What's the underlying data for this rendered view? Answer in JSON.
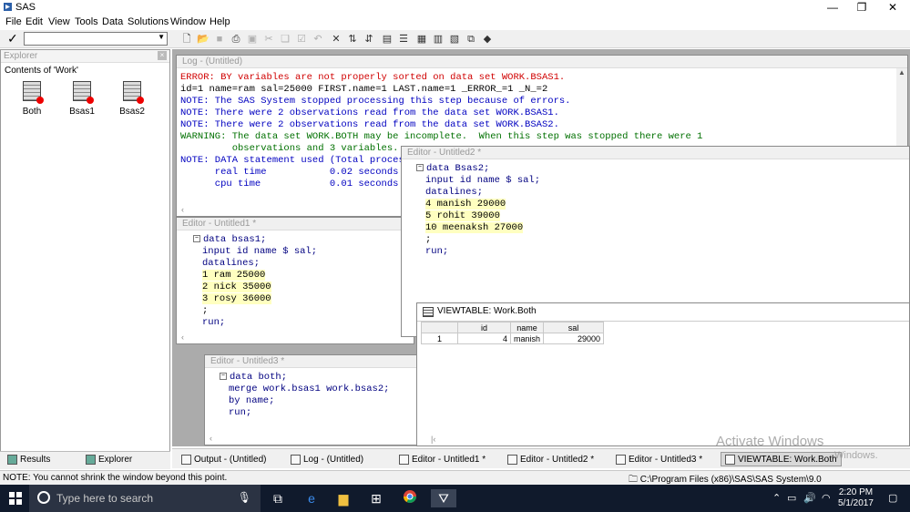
{
  "window": {
    "title": "SAS"
  },
  "menu": [
    "File",
    "Edit",
    "View",
    "Tools",
    "Data",
    "Solutions",
    "Window",
    "Help"
  ],
  "explorer": {
    "header": "Explorer",
    "subtitle": "Contents of 'Work'",
    "datasets": [
      "Both",
      "Bsas1",
      "Bsas2"
    ]
  },
  "left_tabs": {
    "results": "Results",
    "explorer": "Explorer"
  },
  "log": {
    "title": "Log - (Untitled)",
    "lines": [
      {
        "cls": "err",
        "text": "ERROR: BY variables are not properly sorted on data set WORK.BSAS1."
      },
      {
        "cls": "",
        "text": "id=1 name=ram sal=25000 FIRST.name=1 LAST.name=1 _ERROR_=1 _N_=2"
      },
      {
        "cls": "note",
        "text": "NOTE: The SAS System stopped processing this step because of errors."
      },
      {
        "cls": "note",
        "text": "NOTE: There were 2 observations read from the data set WORK.BSAS1."
      },
      {
        "cls": "note",
        "text": "NOTE: There were 2 observations read from the data set WORK.BSAS2."
      },
      {
        "cls": "warn",
        "text": "WARNING: The data set WORK.BOTH may be incomplete.  When this step was stopped there were 1"
      },
      {
        "cls": "warn",
        "text": "         observations and 3 variables."
      },
      {
        "cls": "note",
        "text": "NOTE: DATA statement used (Total process time):"
      },
      {
        "cls": "note",
        "text": "      real time           0.02 seconds"
      },
      {
        "cls": "note",
        "text": "      cpu time            0.01 seconds"
      }
    ]
  },
  "editor1": {
    "title": "Editor - Untitled1 *",
    "lines": [
      "data bsas1;",
      "input id name $ sal;",
      "datalines;",
      "1 ram 25000",
      "2 nick 35000",
      "3 rosy 36000",
      ";",
      "run;"
    ]
  },
  "editor2": {
    "title": "Editor - Untitled2 *",
    "lines": [
      "data Bsas2;",
      "input id name $ sal;",
      "datalines;",
      "4 manish 29000",
      "5 rohit 39000",
      "10 meenaksh 27000",
      ";",
      "run;"
    ]
  },
  "editor3": {
    "title": "Editor - Untitled3 *",
    "lines": [
      "data both;",
      "merge work.bsas1 work.bsas2;",
      "by name;",
      "run;"
    ]
  },
  "viewtable": {
    "title": "VIEWTABLE: Work.Both",
    "columns": [
      "id",
      "name",
      "sal"
    ],
    "rows": [
      {
        "row": "1",
        "id": "4",
        "name": "manish",
        "sal": "29000"
      }
    ]
  },
  "sas_tabs": [
    "Output - (Untitled)",
    "Log - (Untitled)",
    "Editor - Untitled1 *",
    "Editor - Untitled2 *",
    "Editor - Untitled3 *",
    "VIEWTABLE: Work.Both"
  ],
  "watermark": {
    "line1": "Activate Windows",
    "line2": "Windows."
  },
  "status": {
    "message": "NOTE: You cannot shrink the window beyond this point.",
    "path": "C:\\Program Files (x86)\\SAS\\SAS System\\9.0"
  },
  "taskbar": {
    "search_placeholder": "Type here to search",
    "time": "2:20 PM",
    "date": "5/1/2017"
  }
}
